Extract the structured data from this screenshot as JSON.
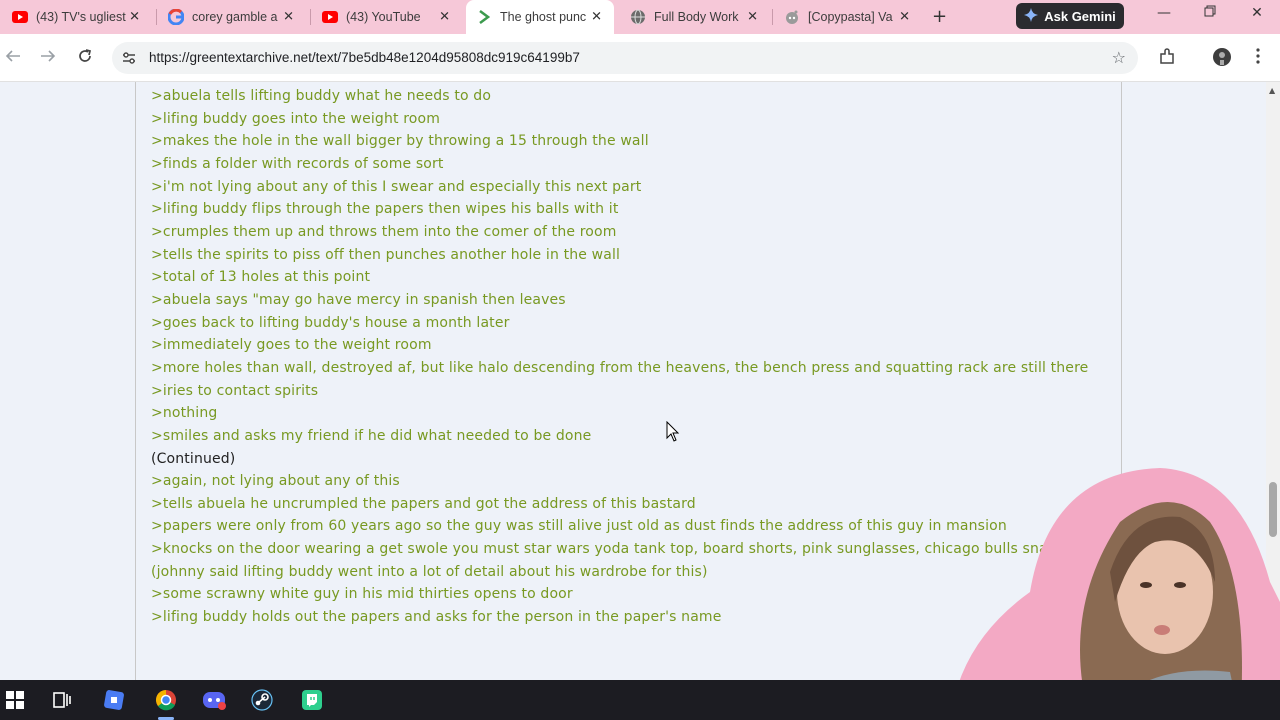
{
  "browser": {
    "tabs": [
      {
        "title": "(43) TV's ugliest",
        "icon": "youtube-icon"
      },
      {
        "title": "corey gamble a",
        "icon": "google-icon"
      },
      {
        "title": "(43) YouTube",
        "icon": "youtube-icon"
      },
      {
        "title": "The ghost punc",
        "icon": "greentext-icon",
        "active": true
      },
      {
        "title": "Full Body Work",
        "icon": "globe-icon"
      },
      {
        "title": "[Copypasta] Va",
        "icon": "reddit-icon"
      }
    ],
    "new_tab": "+",
    "gemini_label": "Ask Gemini",
    "url": "https://greentextarchive.net/text/7be5db48e1204d95808dc919c64199b7"
  },
  "article": {
    "lines": [
      {
        "text": ">abuela tells lifting buddy what he needs to do"
      },
      {
        "text": ">lifing buddy goes into the weight room"
      },
      {
        "text": ">makes the hole in the wall bigger by throwing a 15 through the wall"
      },
      {
        "text": ">finds a folder with records of some sort"
      },
      {
        "text": ">i'm not lying about any of this I swear and especially this next part"
      },
      {
        "text": ">lifing buddy flips through the papers then wipes his balls with it"
      },
      {
        "text": ">crumples them up and throws them into the comer of the room"
      },
      {
        "text": ">tells the spirits to piss off then punches another hole in the wall"
      },
      {
        "text": ">total of 13 holes at this point"
      },
      {
        "text": ">abuela says \"may go have mercy in spanish then leaves"
      },
      {
        "text": ">goes back to lifting buddy's house a month later"
      },
      {
        "text": ">immediately goes to the weight room"
      },
      {
        "text": ">more holes than wall, destroyed af, but like halo descending from the heavens, the bench press and squatting rack are still there"
      },
      {
        "text": ">iries to contact spirits"
      },
      {
        "text": ">nothing"
      },
      {
        "text": ">smiles and asks my friend if he did what needed to be done"
      },
      {
        "text": "(Continued)",
        "plain": true
      },
      {
        "text": ">again, not lying about any of this"
      },
      {
        "text": ">tells abuela he uncrumpled the papers and got the address of this bastard"
      },
      {
        "text": ">papers were only from 60 years ago so the guy was still alive just old as dust finds the address of this guy in mansion"
      },
      {
        "text": ">knocks on the door wearing a get swole you must star wars yoda tank top, board shorts, pink sunglasses, chicago bulls snapback (johnny said lifting buddy went into a lot of detail about his wardrobe for this)"
      },
      {
        "text": ">some scrawny white guy in his mid thirties opens to door"
      },
      {
        "text": ">lifing buddy holds out the papers and asks for the person in the paper's name"
      }
    ]
  },
  "taskbar": {
    "apps": [
      "windows-start-icon",
      "task-view-icon",
      "roblox-icon",
      "chrome-icon",
      "discord-icon",
      "steam-icon",
      "twitch-icon"
    ]
  }
}
